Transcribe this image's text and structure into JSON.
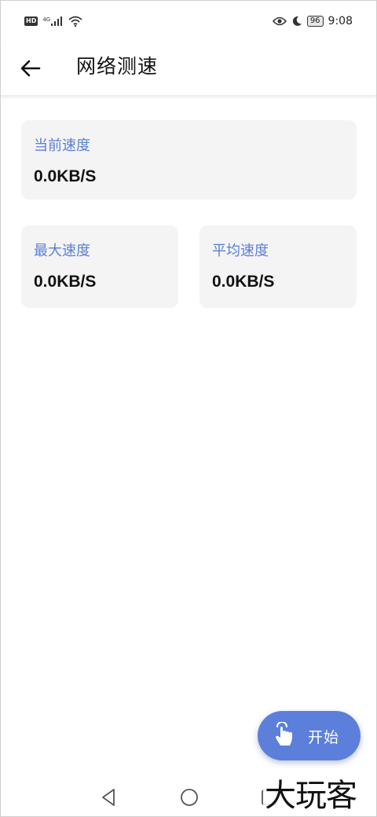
{
  "status_bar": {
    "hd_badge": "HD",
    "network": "4G",
    "battery": "96",
    "time": "9:08",
    "icons": [
      "signal-icon",
      "wifi-icon",
      "eye-icon",
      "moon-icon",
      "battery-icon"
    ]
  },
  "app_bar": {
    "title": "网络测速",
    "back_icon": "arrow-left-icon"
  },
  "cards": {
    "current": {
      "label": "当前速度",
      "value": "0.0KB/S"
    },
    "max": {
      "label": "最大速度",
      "value": "0.0KB/S"
    },
    "average": {
      "label": "平均速度",
      "value": "0.0KB/S"
    }
  },
  "fab": {
    "label": "开始",
    "icon": "tap-hand-icon"
  },
  "nav_bar": {
    "icons": [
      "nav-back-icon",
      "nav-home-icon",
      "nav-recent-icon"
    ]
  },
  "watermark": {
    "text": "大玩客"
  },
  "colors": {
    "accent": "#5b7fdb",
    "label_blue": "#5b7fd6",
    "card_bg": "#f4f4f4",
    "text": "#111111"
  }
}
